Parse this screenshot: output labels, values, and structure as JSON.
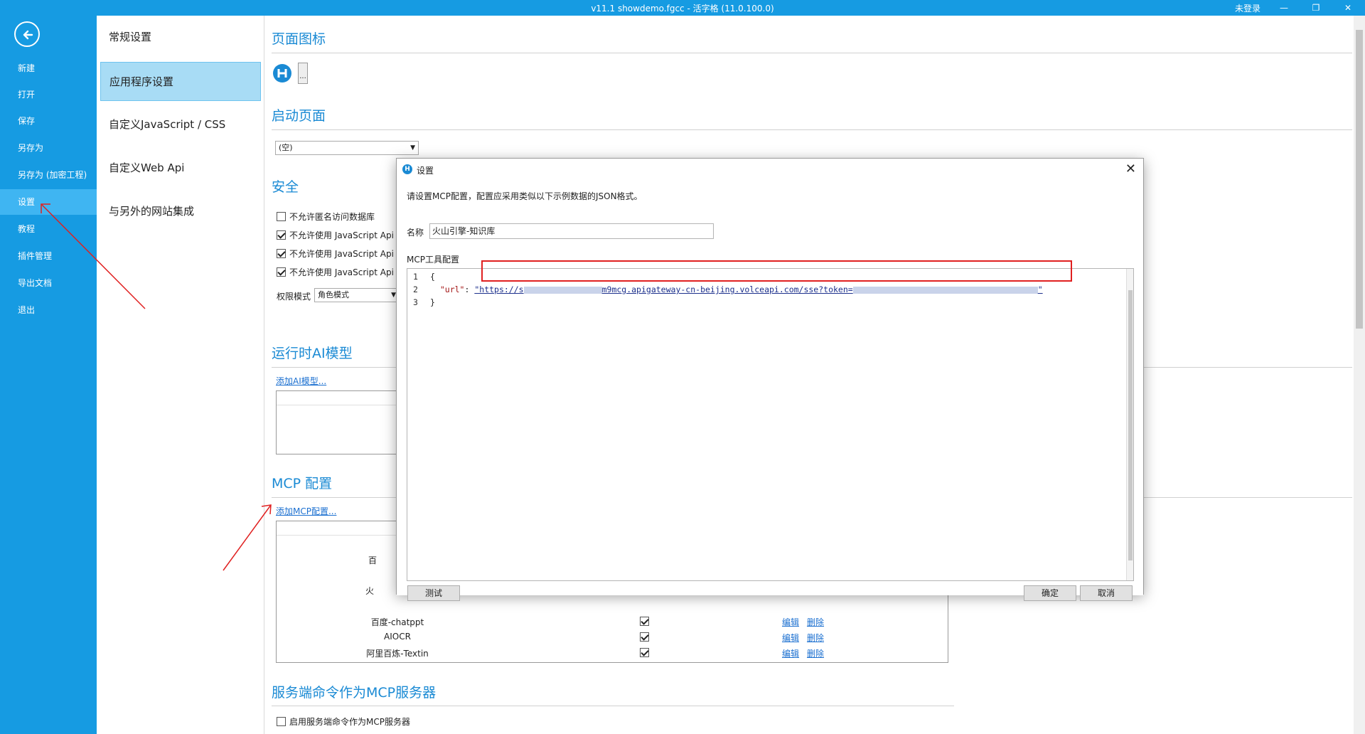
{
  "window": {
    "title": "v11.1 showdemo.fgcc - 活字格 (11.0.100.0)",
    "login": "未登录",
    "minimize": "—",
    "restore": "❐",
    "close": "✕"
  },
  "nav": {
    "items": [
      "新建",
      "打开",
      "保存",
      "另存为",
      "另存为 (加密工程)",
      "设置",
      "教程",
      "插件管理",
      "导出文档",
      "退出"
    ],
    "active": "设置"
  },
  "settings_menu": {
    "items": [
      "常规设置",
      "应用程序设置",
      "自定义JavaScript / CSS",
      "自定义Web Api",
      "与另外的网站集成"
    ],
    "active": "应用程序设置"
  },
  "main": {
    "page_icon_title": "页面图标",
    "page_icon_btn": "...",
    "start_page_title": "启动页面",
    "start_page_value": "(空)",
    "security_title": "安全",
    "security_checks": [
      {
        "label": "不允许匿名访问数据库",
        "checked": false
      },
      {
        "label": "不允许使用 JavaScript Api",
        "checked": true
      },
      {
        "label": "不允许使用 JavaScript Api",
        "checked": true
      },
      {
        "label": "不允许使用 JavaScript Api",
        "checked": true
      }
    ],
    "perm_label": "权限模式",
    "perm_value": "角色模式",
    "ai_title": "运行时AI模型",
    "ai_add": "添加AI模型...",
    "mcp_title": "MCP 配置",
    "mcp_add": "添加MCP配置...",
    "mcp_rows": [
      {
        "name": "百度-chatppt",
        "checked": true,
        "edit": "编辑",
        "delete": "删除"
      },
      {
        "name": "AIOCR",
        "checked": true,
        "edit": "编辑",
        "delete": "删除"
      },
      {
        "name": "阿里百炼-Textin",
        "checked": true,
        "edit": "编辑",
        "delete": "删除"
      }
    ],
    "mcp_partial": [
      "百",
      "火"
    ],
    "server_title": "服务端命令作为MCP服务器",
    "server_check": "启用服务端命令作为MCP服务器"
  },
  "dialog": {
    "title": "设置",
    "icon": "H",
    "close": "✕",
    "instruction": "请设置MCP配置，配置应采用类似以下示例数据的JSON格式。",
    "name_label": "名称",
    "name_value": "火山引擎-知识库",
    "config_label": "MCP工具配置",
    "code_lines": [
      "1",
      "2",
      "3"
    ],
    "code_open": "{",
    "code_key": "\"url\"",
    "code_colon": ": ",
    "code_url_start": "\"https://s",
    "code_url_mid": "m9mcg.apigateway-cn-beijing.volceapi.com/sse?token=",
    "code_url_end": "\"",
    "code_close": "}",
    "test_btn": "测试",
    "ok_btn": "确定",
    "cancel_btn": "取消"
  },
  "colors": {
    "accent": "#169be2",
    "section_title": "#1a8ad4",
    "highlight": "#e02020"
  }
}
